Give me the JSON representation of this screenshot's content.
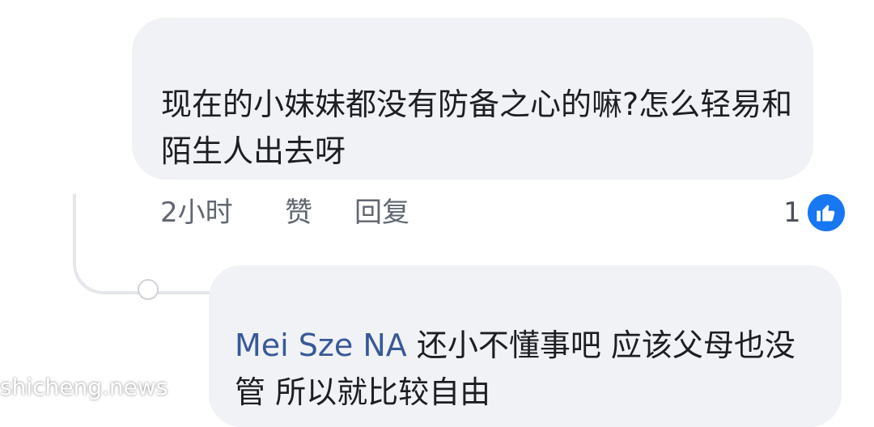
{
  "comment": {
    "text": "现在的小妹妹都没有防备之心的嘛?怎么轻易和陌生人出去呀",
    "time": "2小时",
    "like_label": "赞",
    "reply_label": "回复",
    "reaction_count": "1",
    "reaction_icon": "thumbs-up-icon"
  },
  "reply": {
    "author": "Mei Sze NA",
    "text": "还小不懂事吧 应该父母也没管 所以就比较自由"
  },
  "watermark": "shicheng.news",
  "colors": {
    "bubble": "#f0f2f5",
    "name_link": "#385898",
    "like_blue": "#1877f2"
  }
}
